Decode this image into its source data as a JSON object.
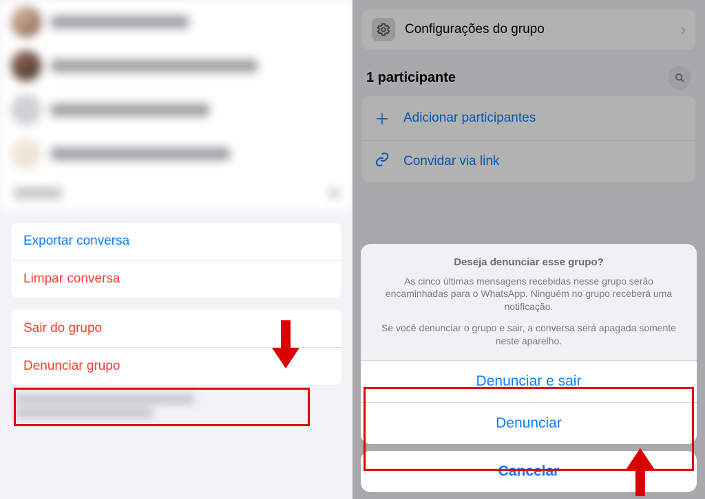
{
  "left": {
    "conversation_actions": {
      "export": "Exportar conversa",
      "clear": "Limpar conversa"
    },
    "group_actions": {
      "leave": "Sair do grupo",
      "report": "Denunciar grupo"
    }
  },
  "right": {
    "settings_label": "Configurações do grupo",
    "participants_title": "1 participante",
    "options": {
      "add": "Adicionar participantes",
      "invite": "Convidar via link"
    },
    "sheet": {
      "title": "Deseja denunciar esse grupo?",
      "body1": "As cinco últimas mensagens recebidas nesse grupo serão encaminhadas para o WhatsApp. Ninguém no grupo receberá uma notificação.",
      "body2": "Se você denunciar o grupo e sair, a conversa será apagada somente neste aparelho.",
      "report_and_leave": "Denunciar e sair",
      "report": "Denunciar",
      "cancel": "Cancelar"
    }
  }
}
